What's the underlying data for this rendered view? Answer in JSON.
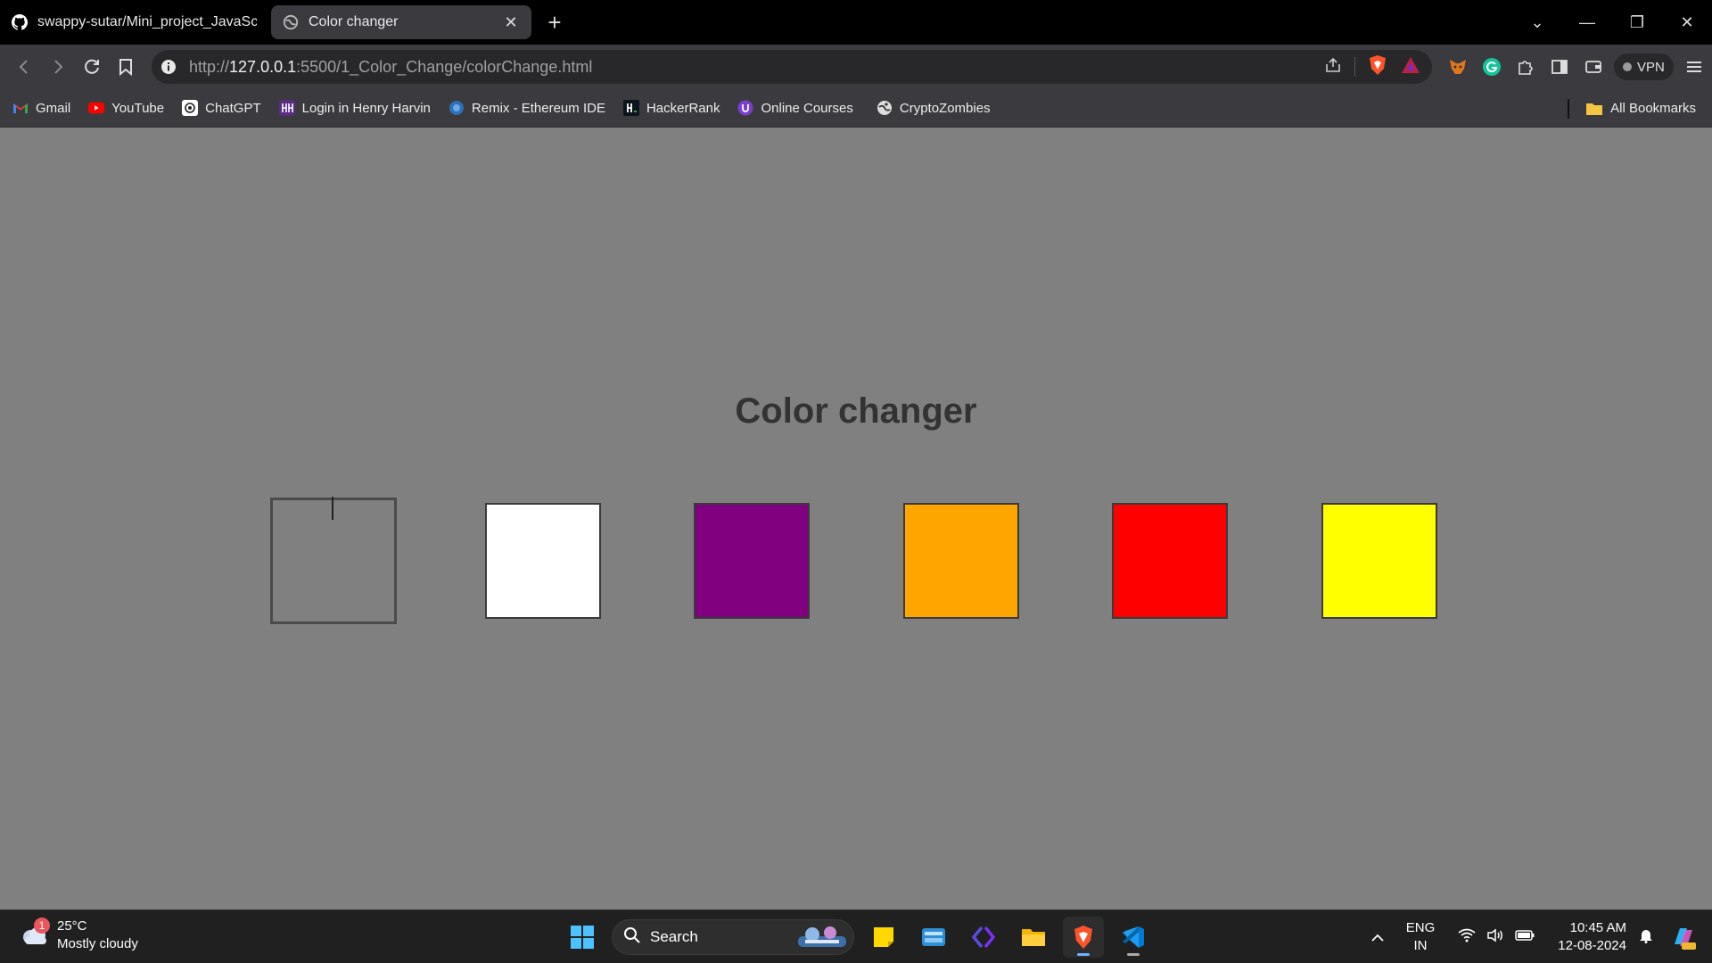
{
  "browser": {
    "tabs": [
      {
        "title": "swappy-sutar/Mini_project_JavaScript",
        "icon": "github-icon",
        "active": false
      },
      {
        "title": "Color changer",
        "icon": "globe-icon",
        "active": true
      }
    ],
    "new_tab_label": "+",
    "window_controls": {
      "tab_search": "⌄",
      "minimize": "—",
      "restore": "❐",
      "close": "✕"
    },
    "address": {
      "scheme": "http://",
      "host": "127.0.0.1",
      "rest": ":5500/1_Color_Change/colorChange.html"
    },
    "vpn_label": "VPN",
    "bookmarks": [
      {
        "label": "Gmail",
        "icon": "gmail-icon"
      },
      {
        "label": "YouTube",
        "icon": "youtube-icon"
      },
      {
        "label": "ChatGPT",
        "icon": "chatgpt-icon"
      },
      {
        "label": "Login in Henry Harvin",
        "icon": "henry-harvin-icon"
      },
      {
        "label": "Remix - Ethereum IDE",
        "icon": "remix-icon"
      },
      {
        "label": "HackerRank",
        "icon": "hackerrank-icon"
      },
      {
        "label": "Online Courses",
        "icon": "courses-icon"
      },
      {
        "label": "CryptoZombies",
        "icon": "cryptozombies-icon"
      }
    ],
    "all_bookmarks_label": "All Bookmarks"
  },
  "page": {
    "heading": "Color changer",
    "swatches": [
      {
        "name": "grey",
        "color": "#808080",
        "selected": true
      },
      {
        "name": "white",
        "color": "#ffffff",
        "selected": false
      },
      {
        "name": "purple",
        "color": "#800080",
        "selected": false
      },
      {
        "name": "orange",
        "color": "#ffa500",
        "selected": false
      },
      {
        "name": "red",
        "color": "#ff0000",
        "selected": false
      },
      {
        "name": "yellow",
        "color": "#ffff00",
        "selected": false
      }
    ]
  },
  "taskbar": {
    "weather": {
      "badge": "1",
      "temp": "25°C",
      "condition": "Mostly cloudy"
    },
    "search_label": "Search",
    "language": {
      "line1": "ENG",
      "line2": "IN"
    },
    "clock": {
      "time": "10:45 AM",
      "date": "12-08-2024"
    }
  }
}
